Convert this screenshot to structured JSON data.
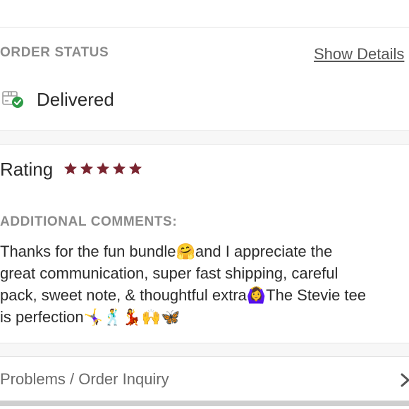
{
  "order_status": {
    "header": "ORDER STATUS",
    "show_details": "Show Details",
    "status_icon": "package-delivered-icon",
    "status": "Delivered"
  },
  "rating": {
    "label": "Rating",
    "stars": 5,
    "max_stars": 5,
    "star_color": "#7a2530"
  },
  "comments": {
    "header": "ADDITIONAL COMMENTS:",
    "text": "Thanks for the fun bundle🤗and I appreciate the\ngreat communication, super fast shipping, careful\npack, sweet note, & thoughtful extra🙆‍♀️The Stevie tee\nis perfection🤸‍♀️🕺💃🙌🦋"
  },
  "inquiry": {
    "label": "Problems / Order Inquiry",
    "icon": "chevron-right-icon"
  },
  "colors": {
    "accent": "#7a2530",
    "check_green": "#2e9b47",
    "muted_text": "#8a8a8a"
  }
}
